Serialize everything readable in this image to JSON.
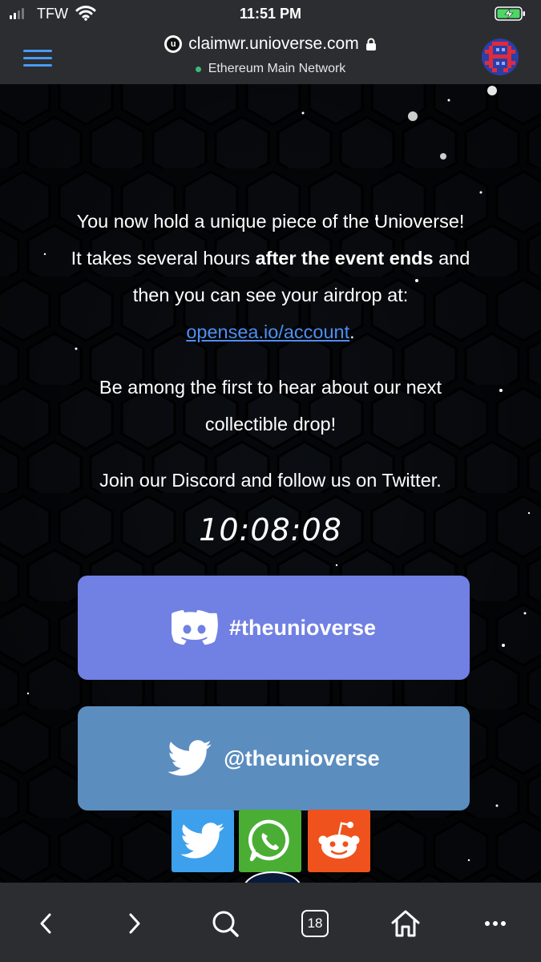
{
  "status_bar": {
    "carrier": "TFW",
    "time": "11:51 PM"
  },
  "browser": {
    "site_icon_letter": "u",
    "url": "claimwr.unioverse.com",
    "network": "Ethereum Main Network",
    "tab_count": "18"
  },
  "page": {
    "line1": "You now hold a unique piece of the Unioverse!",
    "line2_pre": "It takes several hours ",
    "line2_bold": "after the event ends",
    "line2_post": " and",
    "line3": "then you can see your airdrop at:",
    "link": "opensea.io/account",
    "link_suffix": ".",
    "be_among_line1": "Be among the first to hear about our next",
    "be_among_line2": "collectible drop!",
    "join_text": "Join our Discord and follow us on Twitter.",
    "timer": "10:08:08",
    "discord_button": "#theunioverse",
    "twitter_button": "@theunioverse"
  },
  "colors": {
    "discord": "#7180e3",
    "twitter_button": "#5b8dbf",
    "share_twitter": "#3ca0ec",
    "share_whatsapp": "#4aae35",
    "share_reddit": "#f0521d",
    "link": "#4e8ff0",
    "menu_accent": "#4a9cf5"
  },
  "icons": [
    "menu-icon",
    "lock-icon",
    "discord-icon",
    "twitter-icon",
    "whatsapp-icon",
    "reddit-icon",
    "back-icon",
    "forward-icon",
    "search-icon",
    "home-icon",
    "more-icon"
  ]
}
